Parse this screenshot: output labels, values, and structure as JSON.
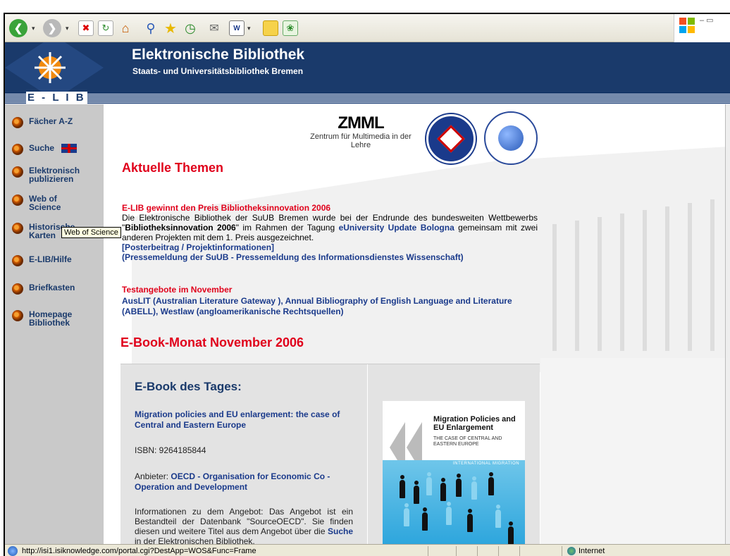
{
  "banner": {
    "title": "Elektronische Bibliothek",
    "subtitle": "Staats- und Universitätsbibliothek Bremen",
    "section_label": "E - L I B"
  },
  "sidebar": {
    "items": [
      {
        "label": "Fächer A-Z"
      },
      {
        "label": "Suche"
      },
      {
        "label": "Elektronisch publizieren"
      },
      {
        "label": "Web of Science"
      },
      {
        "label": "Historische Karten"
      },
      {
        "label": "E-LIB/Hilfe"
      },
      {
        "label": "Briefkasten"
      },
      {
        "label": "Homepage Bibliothek"
      }
    ],
    "tooltip": "Web of Science"
  },
  "logos": {
    "zmml": "ZMML",
    "zmml_text": "Zentrum für Multimedia in der Lehre"
  },
  "main": {
    "heading": "Aktuelle Themen",
    "news1": {
      "title": "E-LIB gewinnt den Preis Bibliotheksinnovation 2006",
      "text_a": "Die Elektronische Bibliothek der SuUB Bremen wurde bei der Endrunde des bundesweiten Wettbewerbs \"",
      "bold_a": "Bibliotheksinnovation 2006",
      "text_b": "\" im Rahmen der Tagung ",
      "link_a": "eUniversity Update Bologna",
      "text_c": " gemeinsam mit zwei anderen Projekten mit dem 1. Preis ausgezeichnet.",
      "link_b": "[Posterbeitrag / Projektinformationen]",
      "link_c": "(Pressemeldung der SuUB  -  Pressemeldung des Informationsdienstes Wissenschaft)"
    },
    "news2": {
      "title": "Testangebote im November",
      "links": "AusLIT (Australian Literature Gateway ), Annual Bibliography of English Language and Literature (ABELL), Westlaw (angloamerikanische Rechtsquellen)"
    },
    "ebook_month": "E-Book-Monat  November 2006",
    "ebook": {
      "heading": "E-Book des Tages:",
      "title": "Migration policies and EU enlargement: the case of Central and Eastern Europe",
      "isbn": "ISBN: 9264185844",
      "provider_label": "Anbieter: ",
      "provider": "OECD - Organisation for Economic Co - Operation and Development",
      "info_a": "Informationen zu dem Angebot: Das Angebot ist ein Bestandteil der Datenbank \"SourceOECD\". Sie finden diesen und weitere Titel aus dem Angebot über die ",
      "info_link": "Suche",
      "info_b": " in der Elektronischen Bibliothek.",
      "cover_title": "Migration Policies and EU Enlargement",
      "cover_sub": "THE CASE OF CENTRAL AND EASTERN EUROPE",
      "cover_band": "INTERNATIONAL MIGRATION"
    }
  },
  "status": {
    "url": "http://isi1.isiknowledge.com/portal.cgi?DestApp=WOS&Func=Frame",
    "zone": "Internet"
  },
  "colors": {
    "accent_red": "#e0001b",
    "navy": "#1a3a6b",
    "link_blue": "#1a3a8b"
  }
}
